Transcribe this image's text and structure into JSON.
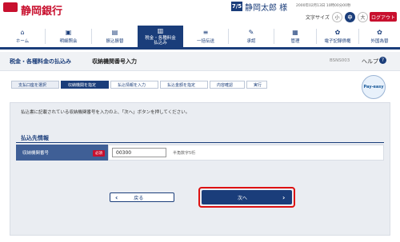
{
  "header": {
    "bank_name": "静岡銀行",
    "user_badge": "7/5",
    "user_name": "静岡太郎 様",
    "login_time": "2000年02月13日 10時00分00秒",
    "font_size_label": "文字サイズ",
    "font_sizes": [
      "小",
      "中",
      "大"
    ],
    "logout_label": "ログアウト"
  },
  "nav": {
    "items": [
      {
        "label": "ホーム",
        "icon": "⌂"
      },
      {
        "label": "明細照会",
        "icon": "▣"
      },
      {
        "label": "振込振替",
        "icon": "▤"
      },
      {
        "label": "税金・各種料金\n払込み",
        "icon": "▥"
      },
      {
        "label": "一括伝送",
        "icon": "≡"
      },
      {
        "label": "承認",
        "icon": "✎"
      },
      {
        "label": "管理",
        "icon": "▦"
      },
      {
        "label": "電子記録債権",
        "icon": "✿"
      },
      {
        "label": "外国為替",
        "icon": "✿"
      }
    ]
  },
  "titlebar": {
    "category": "税金・各種料金の払込み",
    "title": "収納機関番号入力",
    "screen_code": "BSNS003",
    "help_label": "ヘルプ",
    "help_icon": "?"
  },
  "steps": [
    "支払口座を選択",
    "収納機関を指定",
    "払込情報を入力",
    "払込金額を指定",
    "内容確認",
    "実行"
  ],
  "payeasy_label": "Pay-easy",
  "main": {
    "instruction": "払込書に記載されている収納機関番号を入力の上、「次へ」ボタンを押してください。",
    "section_title": "払込先情報",
    "field_label": "収納機関番号",
    "required_badge": "必須",
    "field_value": "00300",
    "field_hint": "半角数字5桁"
  },
  "buttons": {
    "back_label": "戻る",
    "next_label": "次へ"
  },
  "colors": {
    "brand": "#c8102e",
    "primary": "#1a3d7a",
    "highlight": "#dd1111"
  }
}
